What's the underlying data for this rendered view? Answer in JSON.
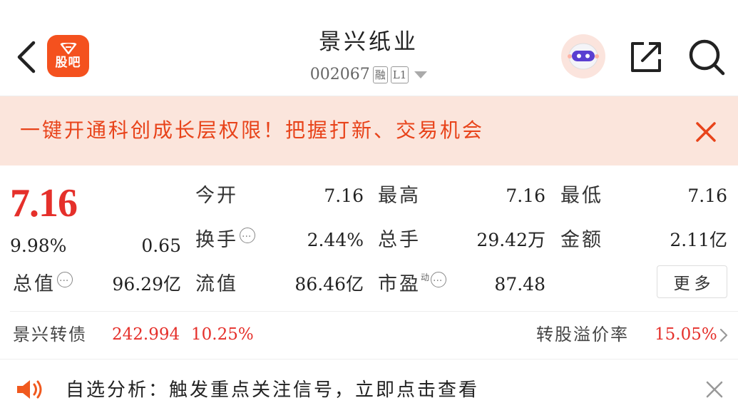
{
  "header": {
    "app_logo_label": "股吧",
    "stock_name": "景兴纸业",
    "stock_code": "002067",
    "tags": [
      "融",
      "L1"
    ]
  },
  "banner": {
    "text": "一键开通科创成长层权限！把握打新、交易机会"
  },
  "quote": {
    "price": "7.16",
    "change_pct": "9.98%",
    "change_amt": "0.65",
    "open_label": "今开",
    "open_value": "7.16",
    "high_label": "最高",
    "high_value": "7.16",
    "low_label": "最低",
    "low_value": "7.16",
    "turnover_label": "换手",
    "turnover_value": "2.44%",
    "volume_label": "总手",
    "volume_value": "29.42万",
    "amount_label": "金额",
    "amount_value": "2.11亿",
    "mktcap_label": "总值",
    "mktcap_value": "96.29亿",
    "float_label": "流值",
    "float_value": "86.46亿",
    "pe_label": "市盈",
    "pe_sup": "动",
    "pe_value": "87.48",
    "more_label": "更多"
  },
  "bond": {
    "label": "景兴转债",
    "price": "242.994",
    "change_pct": "10.25%",
    "premium_label": "转股溢价率",
    "premium_value": "15.05%"
  },
  "notice": {
    "text": "自选分析：触发重点关注信号，立即点击查看"
  },
  "colors": {
    "up_red": "#e5302b",
    "banner_bg": "#fbe5dc",
    "banner_text": "#e8431a",
    "logo_bg": "#f4511e"
  }
}
